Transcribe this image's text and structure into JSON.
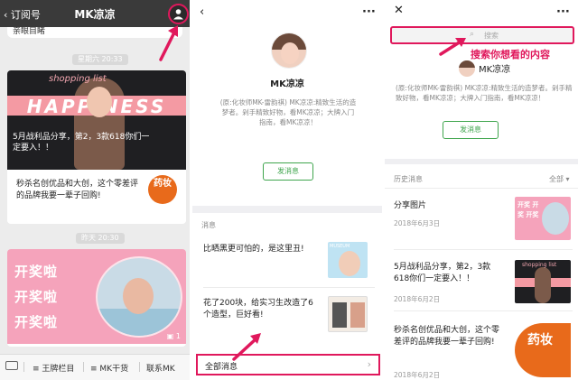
{
  "panel1": {
    "back_label": "订阅号",
    "title": "MK凉凉",
    "prev_bubble_text": "亲眼目睹",
    "time1": "星期六 20:33",
    "article1": {
      "cover_top_text": "shopping list",
      "cover_band_text": "HAPPINESS",
      "cover_caption": "5月战利品分享，第2，3款618你们一定要入！！",
      "second_title": "秒杀名创优品和大创，这个零差评的品牌我要一辈子回购!",
      "second_thumb_text": "药妆"
    },
    "time2": "昨天 20:30",
    "article2": {
      "lines": [
        "开奖啦",
        "开奖啦",
        "开奖啦"
      ],
      "image_count": "1"
    },
    "tabs": [
      "王牌栏目",
      "MK干货",
      "联系MK"
    ]
  },
  "panel2": {
    "name": "MK凉凉",
    "desc": "(原:化妆师MK-雷韵祺) MK凉凉:精致生活的造梦者。剁手精致好物，看MK凉凉；大牌入门指南，看MK凉凉！",
    "send_button": "发消息",
    "section_label": "消息",
    "messages": [
      {
        "title": "比晒黑更可怕的，是这里丑!",
        "thumb_text": "MUSEUM"
      },
      {
        "title": "花了200块，给实习生改造了6个造型，巨好看!",
        "thumb_text": ""
      }
    ],
    "all_messages": "全部消息"
  },
  "panel3": {
    "search_placeholder": "搜索",
    "annotation": "搜索你想看的内容",
    "name": "MK凉凉",
    "desc": "(原:化妆师MK-雷韵祺) MK凉凉:精致生活的造梦者。剁手精致好物，看MK凉凉；大牌入门指南，看MK凉凉！",
    "send_button": "发消息",
    "history_label": "历史消息",
    "filter_label": "全部",
    "history": [
      {
        "title": "分享图片",
        "date": "2018年6月3日",
        "thumb_text": "开奖 开奖 开奖"
      },
      {
        "title": "5月战利品分享，第2，3款618你们一定要入！！",
        "date": "2018年6月2日",
        "thumb_text": "shopping list"
      },
      {
        "title": "秒杀名创优品和大创，这个零差评的品牌我要一辈子回购!",
        "date": "2018年6月2日",
        "thumb_text": "药妆"
      }
    ]
  },
  "colors": {
    "highlight": "#e0185c",
    "wechat_green": "#3fa54d",
    "header_dark": "#3a3a3a",
    "pink_cover": "#f5a3bb"
  }
}
